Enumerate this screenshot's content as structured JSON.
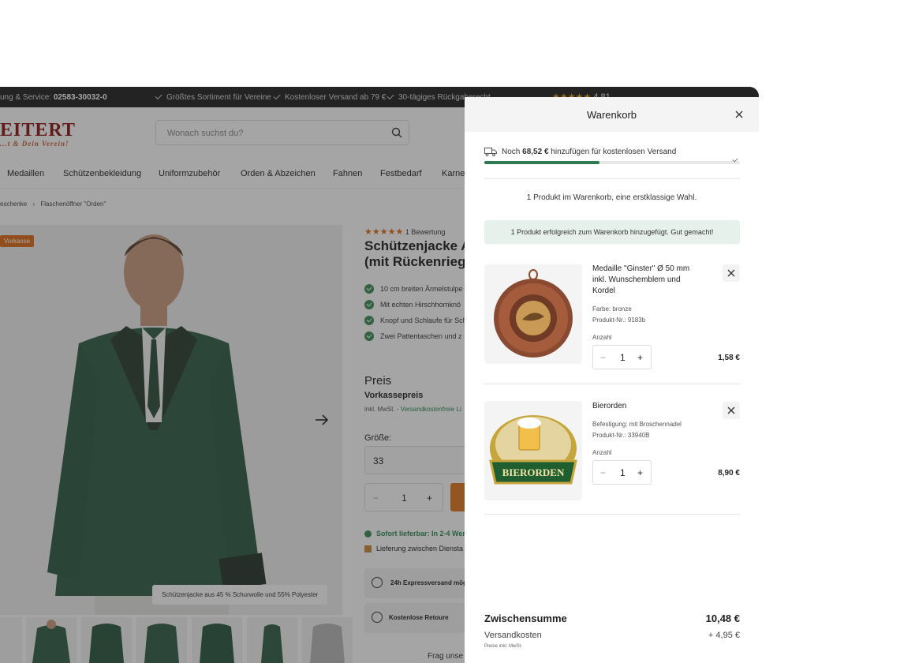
{
  "infobar": {
    "service_prefix": "ung & Service: ",
    "service_phone": "02583-30032-0",
    "usp1": "Größtes Sortiment für Vereine",
    "usp2": "Kostenloser Versand ab 79 €",
    "usp3": "30-tägiges Rückgaberecht",
    "rating": "4,81"
  },
  "header": {
    "logo": "EITERT",
    "logo_sub": "...t & Dein Verein!",
    "search_placeholder": "Wonach suchst du?"
  },
  "nav": {
    "items": [
      "Medaillen",
      "Schützenbekleidung",
      "Uniformzubehör",
      "Orden & Abzeichen",
      "Fahnen",
      "Festbedarf",
      "Karnev"
    ]
  },
  "breadcrumb": {
    "prev": "eschenke",
    "current": "Flaschenöffner \"Orden\""
  },
  "product": {
    "badge": "Vorkasse",
    "image_caption": "Schützenjacke aus 45 % Schurwolle und 55% Polyester",
    "rating_text": "1 Bewertung",
    "title_line1": "Schützenjacke Al",
    "title_line2": "(mit Rückenriegel",
    "features": [
      "10 cm breiten Ärmelstulpe",
      "Mit echten Hirschhornknö",
      "Knopf und Schlaufe für Sch",
      "Zwei Pattentaschen und z"
    ],
    "price_label": "Preis",
    "price_type": "Vorkassepreis",
    "tax_note": "inkl. MwSt. -",
    "shipping_link": "Versandkostenfreie Li",
    "size_label": "Größe:",
    "size_value": "33",
    "qty": "1",
    "availability": "Sofort lieferbar: In 2-4 Wer",
    "delivery": "Lieferung zwischen Diensta",
    "express": "24h Expressversand mög",
    "returns": "Kostenlose Retoure",
    "ask": "Frag unse"
  },
  "cart": {
    "title": "Warenkorb",
    "ship_prefix": "Noch",
    "ship_amount": "68,52 €",
    "ship_suffix": "hinzufügen für kostenlosen Versand",
    "ship_progress": 0.45,
    "count_text": "1 Produkt im Warenkorb, eine erstklassige Wahl.",
    "success_text": "1 Produkt erfolgreich zum Warenkorb hinzugefügt. Gut gemacht!",
    "items": [
      {
        "name": "Medaille \"Ginster\" Ø 50 mm inkl. Wunschemblem und Kordel",
        "meta1": "Farbe: bronze",
        "meta2": "Produkt-Nr.: 9183b",
        "qty_label": "Anzahl",
        "qty": "1",
        "price": "1,58 €"
      },
      {
        "name": "Bierorden",
        "meta1": "Befestigung: mit Broschennadel",
        "meta2": "Produkt-Nr.: 33940B",
        "qty_label": "Anzahl",
        "qty": "1",
        "price": "8,90 €",
        "image_text": "BIERORDEN"
      }
    ],
    "subtotal_label": "Zwischensumme",
    "subtotal_value": "10,48 €",
    "shipping_label": "Versandkosten",
    "shipping_value": "+ 4,95 €",
    "vat_note": "Preise inkl. MwSt."
  }
}
